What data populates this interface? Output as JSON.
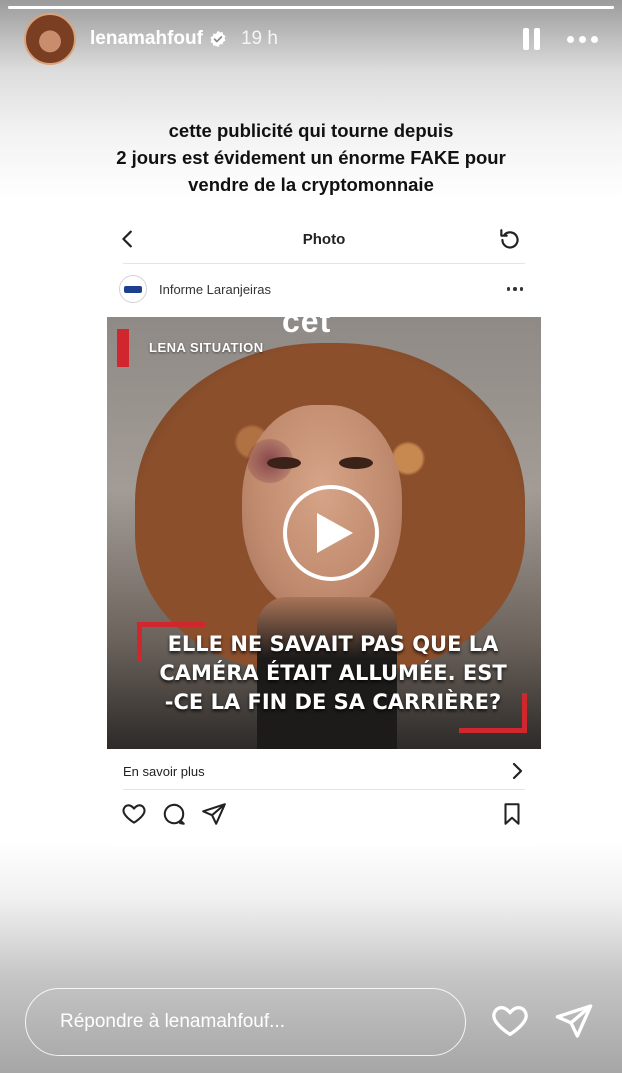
{
  "story": {
    "username": "lenamahfouf",
    "time": "19 h",
    "progress": 1.0,
    "caption_lines": [
      "cette publicité qui tourne depuis",
      "2 jours est évidement un énorme FAKE pour",
      "vendre de la cryptomonnaie"
    ]
  },
  "screenshot": {
    "topbar_title": "Photo",
    "post_author": "Informe Laranjeiras",
    "media": {
      "top_word": "cet",
      "label": "LENA SITUATION",
      "overlay_lines": [
        "ELLE NE SAVAIT PAS QUE LA",
        "CAMÉRA ÉTAIT ALLUMÉE. EST",
        "-CE LA FIN DE SA CARRIÈRE?"
      ]
    },
    "learn_more": "En savoir plus"
  },
  "reply": {
    "placeholder": "Répondre à lenamahfouf..."
  },
  "colors": {
    "accent_red": "#d0262d",
    "verified_blue": "#ffffff"
  }
}
